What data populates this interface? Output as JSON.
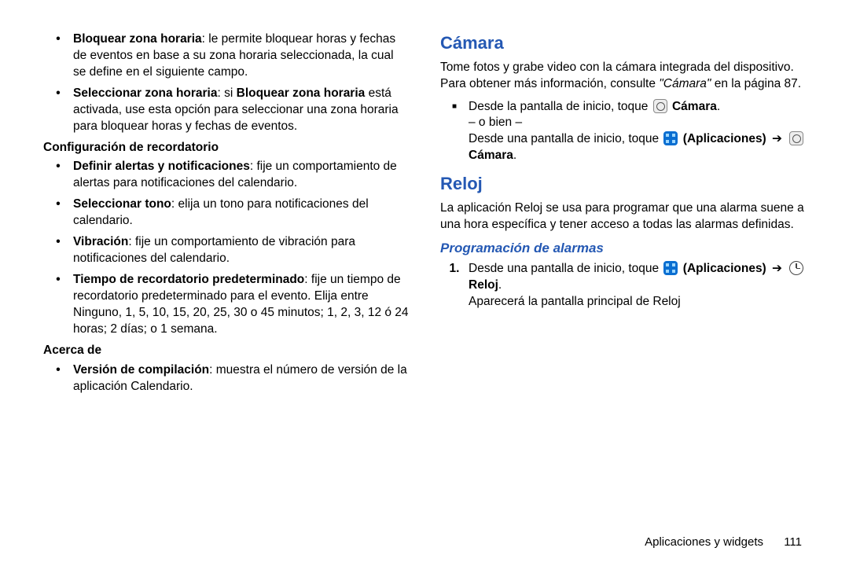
{
  "leftColumn": {
    "items": [
      {
        "title": "Bloquear zona horaria",
        "rest": ": le permite bloquear horas y fechas de eventos en base a su zona horaria seleccionada, la cual se define en el siguiente campo."
      },
      {
        "title": "Seleccionar zona horaria",
        "mid": ": si ",
        "title2": "Bloquear zona horaria",
        "rest": " está activada, use esta opción para seleccionar una zona horaria para bloquear horas y fechas de eventos."
      }
    ],
    "subhead1": "Configuración de recordatorio",
    "items2": [
      {
        "title": "Definir alertas y notificaciones",
        "rest": ": fije un comportamiento de alertas para notificaciones del calendario."
      },
      {
        "title": "Seleccionar tono",
        "rest": ": elija un tono para notificaciones del calendario."
      },
      {
        "title": "Vibración",
        "rest": ": fije un comportamiento de vibración para notificaciones del calendario."
      },
      {
        "title": "Tiempo de recordatorio predeterminado",
        "rest": ": fije un tiempo de recordatorio predeterminado para el evento. Elija entre Ninguno, 1, 5, 10, 15, 20, 25, 30 o 45 minutos; 1, 2, 3, 12 ó 24 horas; 2 días; o 1 semana."
      }
    ],
    "subhead2": "Acerca de",
    "items3": [
      {
        "title": "Versión de compilación",
        "rest": ": muestra el número de versión de la aplicación Calendario."
      }
    ]
  },
  "rightColumn": {
    "h2_camera": "Cámara",
    "cameraIntro_a": "Tome fotos y grabe video con la cámara integrada del dispositivo. Para obtener más información, consulte ",
    "cameraIntro_ref": "\"Cámara\"",
    "cameraIntro_b": " en la página 87.",
    "step1_a": "Desde la pantalla de inicio, toque ",
    "step1_camLabel": "Cámara",
    "step1_or": "– o bien –",
    "step1_b": "Desde una pantalla de inicio, toque ",
    "step1_appsLabel": "(Aplicaciones)",
    "step1_arrow": "➔",
    "step1_camLabel2": "Cámara",
    "h2_clock": "Reloj",
    "clockIntro": "La aplicación Reloj se usa para programar que una alarma suene a una hora específica y tener acceso a todas las alarmas definidas.",
    "h3_alarms": "Programación de alarmas",
    "alarm1_num": "1.",
    "alarm1_a": "Desde una pantalla de inicio, toque ",
    "alarm1_appsLabel": "(Aplicaciones)",
    "alarm1_arrow": "➔",
    "alarm1_clockLabel": "Reloj",
    "alarm1_b": "Aparecerá la pantalla principal de Reloj"
  },
  "footer": {
    "section": "Aplicaciones y widgets",
    "page": "111"
  }
}
